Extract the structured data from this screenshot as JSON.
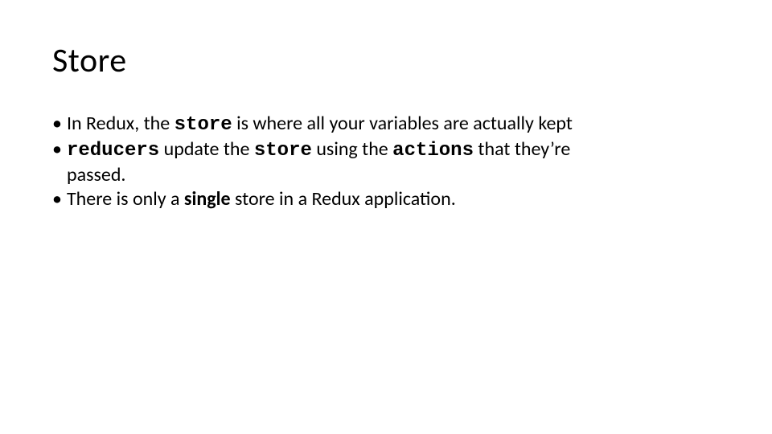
{
  "bulletChar": "•",
  "title": "Store",
  "bullets": {
    "b1": {
      "t1": "In Redux, the ",
      "code1": "store",
      "t2": " is where all your variables are actually kept"
    },
    "b2": {
      "code1": "reducers",
      "t1": " update the ",
      "code2": "store",
      "t2": " using the ",
      "code3": "actions",
      "t3": " that they’re",
      "cont": "passed."
    },
    "b3": {
      "t1": "There is only a ",
      "bold1": "single",
      "t2": " store in a Redux application."
    }
  }
}
